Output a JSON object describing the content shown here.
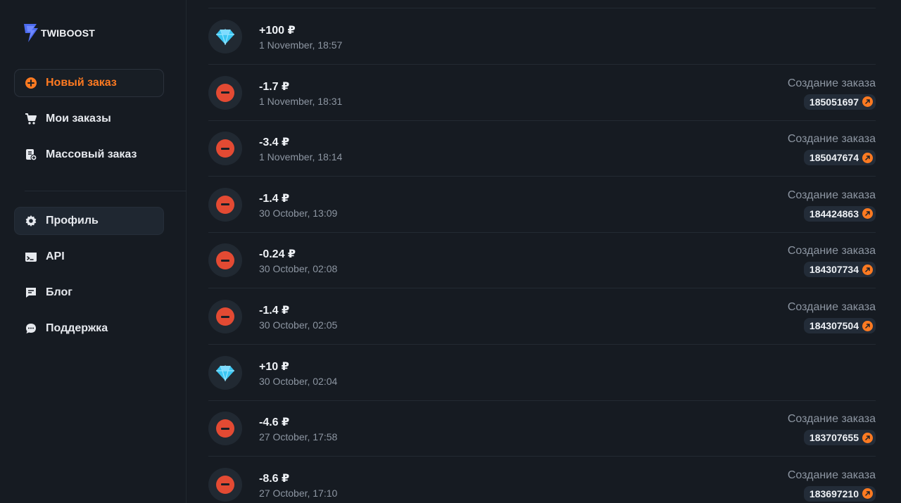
{
  "brand": {
    "name": "TWIBOOST"
  },
  "nav_top": [
    {
      "label": "Новый заказ",
      "icon": "plus-circle-icon"
    },
    {
      "label": "Мои заказы",
      "icon": "cart-icon"
    },
    {
      "label": "Массовый заказ",
      "icon": "mass-order-icon"
    }
  ],
  "nav_bottom": [
    {
      "label": "Профиль",
      "icon": "gear-icon"
    },
    {
      "label": "API",
      "icon": "terminal-icon"
    },
    {
      "label": "Блог",
      "icon": "message-square-icon"
    },
    {
      "label": "Поддержка",
      "icon": "chat-bubble-icon"
    }
  ],
  "colors": {
    "accent": "#ff7a21",
    "debit": "#e34a33",
    "credit": "#3bc6f2"
  },
  "transactions": [
    {
      "kind": "credit",
      "amount": "+100 ₽",
      "date": "1 November, 18:57"
    },
    {
      "kind": "debit",
      "amount": "-1.7 ₽",
      "date": "1 November, 18:31",
      "type": "Создание заказа",
      "order": "185051697"
    },
    {
      "kind": "debit",
      "amount": "-3.4 ₽",
      "date": "1 November, 18:14",
      "type": "Создание заказа",
      "order": "185047674"
    },
    {
      "kind": "debit",
      "amount": "-1.4 ₽",
      "date": "30 October, 13:09",
      "type": "Создание заказа",
      "order": "184424863"
    },
    {
      "kind": "debit",
      "amount": "-0.24 ₽",
      "date": "30 October, 02:08",
      "type": "Создание заказа",
      "order": "184307734"
    },
    {
      "kind": "debit",
      "amount": "-1.4 ₽",
      "date": "30 October, 02:05",
      "type": "Создание заказа",
      "order": "184307504"
    },
    {
      "kind": "credit",
      "amount": "+10 ₽",
      "date": "30 October, 02:04"
    },
    {
      "kind": "debit",
      "amount": "-4.6 ₽",
      "date": "27 October, 17:58",
      "type": "Создание заказа",
      "order": "183707655"
    },
    {
      "kind": "debit",
      "amount": "-8.6 ₽",
      "date": "27 October, 17:10",
      "type": "Создание заказа",
      "order": "183697210"
    }
  ]
}
